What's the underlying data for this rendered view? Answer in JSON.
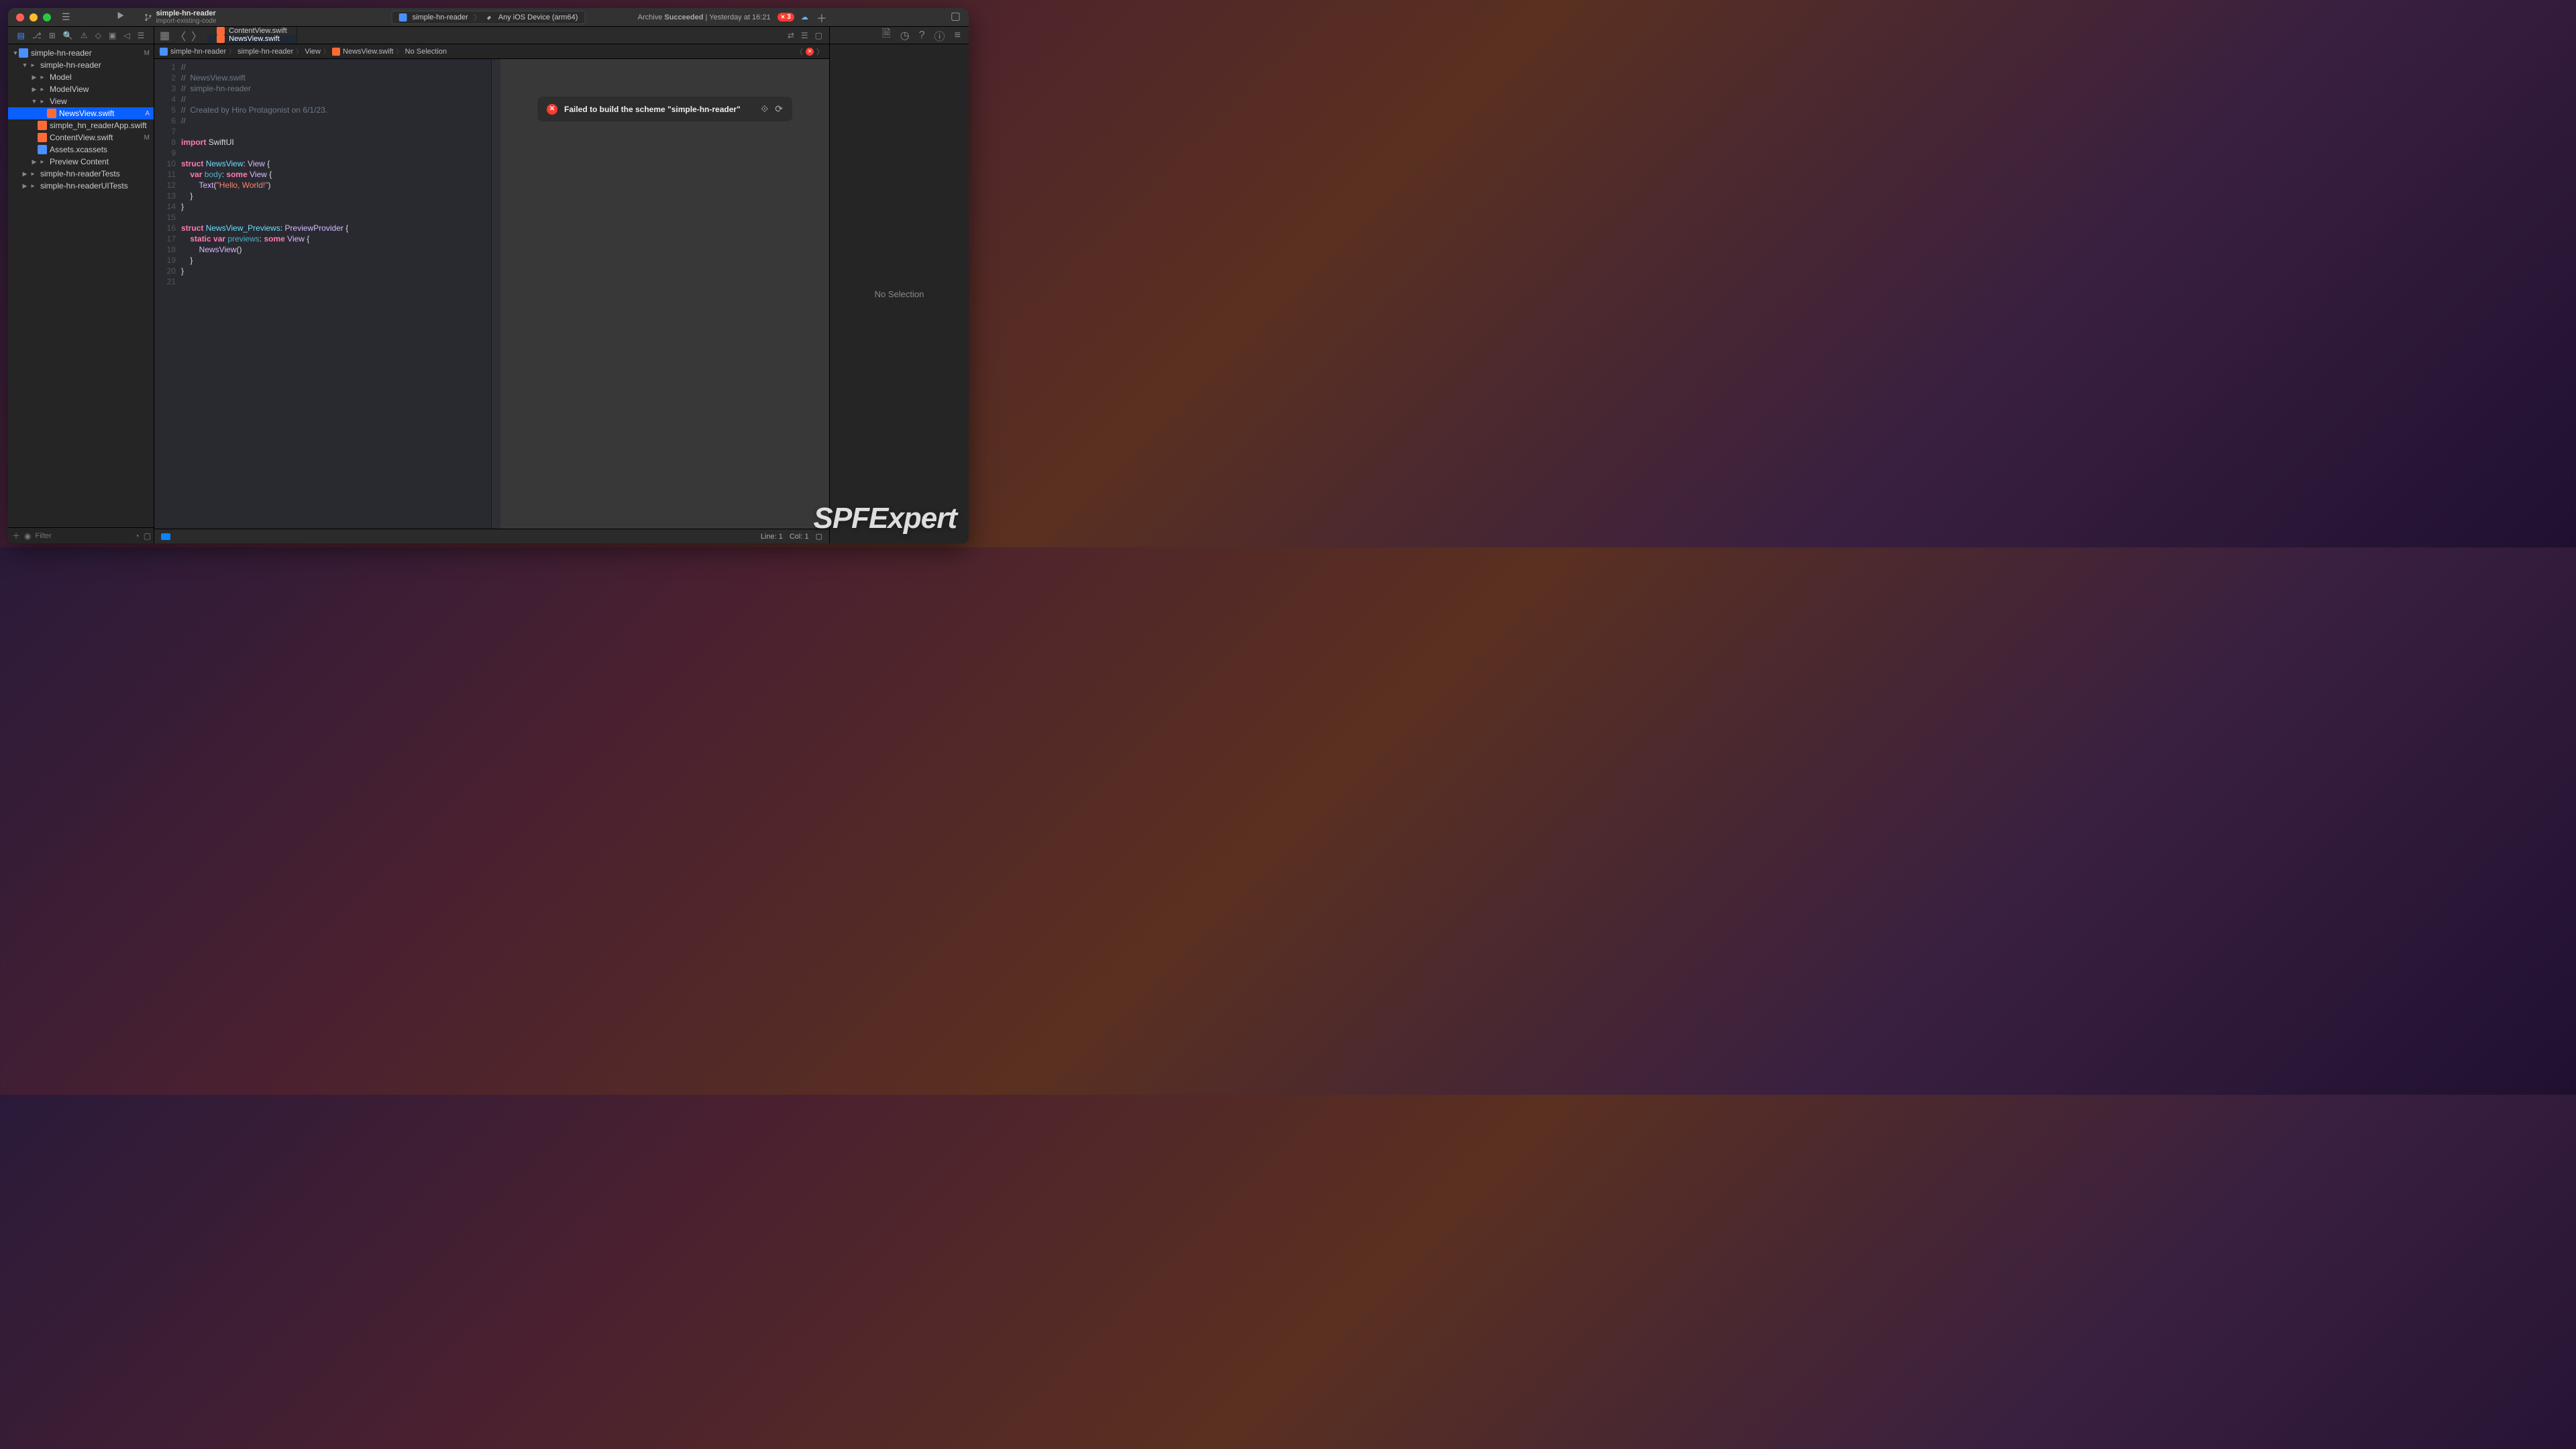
{
  "window": {
    "project_name": "simple-hn-reader",
    "branch_label": "import-existing-code",
    "scheme": "simple-hn-reader",
    "device": "Any iOS Device (arm64)",
    "status_prefix": "Archive ",
    "status_bold": "Succeeded",
    "status_suffix": " | Yesterday at 16:21",
    "error_count": "3"
  },
  "tabs": [
    {
      "label": "ContentView.swift",
      "active": false
    },
    {
      "label": "NewsView.swift",
      "active": true
    }
  ],
  "crumbs": {
    "items": [
      "simple-hn-reader",
      "simple-hn-reader",
      "View",
      "NewsView.swift",
      "No Selection"
    ]
  },
  "tree": [
    {
      "depth": 0,
      "chev": "▼",
      "icon": "proj",
      "label": "simple-hn-reader",
      "badge": "M"
    },
    {
      "depth": 1,
      "chev": "▼",
      "icon": "folder",
      "label": "simple-hn-reader",
      "badge": ""
    },
    {
      "depth": 2,
      "chev": "▶",
      "icon": "folder",
      "label": "Model",
      "badge": ""
    },
    {
      "depth": 2,
      "chev": "▶",
      "icon": "folder",
      "label": "ModelView",
      "badge": ""
    },
    {
      "depth": 2,
      "chev": "▼",
      "icon": "folder",
      "label": "View",
      "badge": ""
    },
    {
      "depth": 3,
      "chev": "",
      "icon": "swift",
      "label": "NewsView.swift",
      "badge": "A",
      "selected": true
    },
    {
      "depth": 2,
      "chev": "",
      "icon": "swift",
      "label": "simple_hn_readerApp.swift",
      "badge": ""
    },
    {
      "depth": 2,
      "chev": "",
      "icon": "swift",
      "label": "ContentView.swift",
      "badge": "M"
    },
    {
      "depth": 2,
      "chev": "",
      "icon": "assets",
      "label": "Assets.xcassets",
      "badge": ""
    },
    {
      "depth": 2,
      "chev": "▶",
      "icon": "folder",
      "label": "Preview Content",
      "badge": ""
    },
    {
      "depth": 1,
      "chev": "▶",
      "icon": "folder",
      "label": "simple-hn-readerTests",
      "badge": ""
    },
    {
      "depth": 1,
      "chev": "▶",
      "icon": "folder",
      "label": "simple-hn-readerUITests",
      "badge": ""
    }
  ],
  "sidebar_filter_placeholder": "Filter",
  "code": {
    "lines": [
      [
        {
          "t": "comment",
          "s": "//"
        }
      ],
      [
        {
          "t": "comment",
          "s": "//  NewsView.swift"
        }
      ],
      [
        {
          "t": "comment",
          "s": "//  simple-hn-reader"
        }
      ],
      [
        {
          "t": "comment",
          "s": "//"
        }
      ],
      [
        {
          "t": "comment",
          "s": "//  Created by Hiro Protagonist on 6/1/23."
        }
      ],
      [
        {
          "t": "comment",
          "s": "//"
        }
      ],
      [],
      [
        {
          "t": "keyword",
          "s": "import"
        },
        {
          "t": "plain",
          "s": " "
        },
        {
          "t": "plain",
          "s": "SwiftUI"
        }
      ],
      [],
      [
        {
          "t": "keyword",
          "s": "struct"
        },
        {
          "t": "plain",
          "s": " "
        },
        {
          "t": "id",
          "s": "NewsView"
        },
        {
          "t": "plain",
          "s": ": "
        },
        {
          "t": "type",
          "s": "View"
        },
        {
          "t": "plain",
          "s": " {"
        }
      ],
      [
        {
          "t": "plain",
          "s": "    "
        },
        {
          "t": "keyword",
          "s": "var"
        },
        {
          "t": "plain",
          "s": " "
        },
        {
          "t": "decl",
          "s": "body"
        },
        {
          "t": "plain",
          "s": ": "
        },
        {
          "t": "keyword",
          "s": "some"
        },
        {
          "t": "plain",
          "s": " "
        },
        {
          "t": "type",
          "s": "View"
        },
        {
          "t": "plain",
          "s": " {"
        }
      ],
      [
        {
          "t": "plain",
          "s": "        "
        },
        {
          "t": "type",
          "s": "Text"
        },
        {
          "t": "plain",
          "s": "("
        },
        {
          "t": "string",
          "s": "\"Hello, World!\""
        },
        {
          "t": "plain",
          "s": ")"
        }
      ],
      [
        {
          "t": "plain",
          "s": "    }"
        }
      ],
      [
        {
          "t": "plain",
          "s": "}"
        }
      ],
      [],
      [
        {
          "t": "keyword",
          "s": "struct"
        },
        {
          "t": "plain",
          "s": " "
        },
        {
          "t": "id",
          "s": "NewsView_Previews"
        },
        {
          "t": "plain",
          "s": ": "
        },
        {
          "t": "type",
          "s": "PreviewProvider"
        },
        {
          "t": "plain",
          "s": " {"
        }
      ],
      [
        {
          "t": "plain",
          "s": "    "
        },
        {
          "t": "keyword",
          "s": "static"
        },
        {
          "t": "plain",
          "s": " "
        },
        {
          "t": "keyword",
          "s": "var"
        },
        {
          "t": "plain",
          "s": " "
        },
        {
          "t": "decl",
          "s": "previews"
        },
        {
          "t": "plain",
          "s": ": "
        },
        {
          "t": "keyword",
          "s": "some"
        },
        {
          "t": "plain",
          "s": " "
        },
        {
          "t": "type",
          "s": "View"
        },
        {
          "t": "plain",
          "s": " {"
        }
      ],
      [
        {
          "t": "plain",
          "s": "        "
        },
        {
          "t": "type",
          "s": "NewsView"
        },
        {
          "t": "plain",
          "s": "()"
        }
      ],
      [
        {
          "t": "plain",
          "s": "    }"
        }
      ],
      [
        {
          "t": "plain",
          "s": "}"
        }
      ],
      []
    ]
  },
  "preview_error": "Failed to build the scheme \"simple-hn-reader\"",
  "inspector_placeholder": "No Selection",
  "statusbar": {
    "line": "Line: 1",
    "col": "Col: 1"
  },
  "watermark": "SPFExpert"
}
